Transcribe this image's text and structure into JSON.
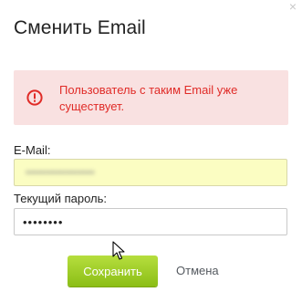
{
  "dialog": {
    "title": "Сменить Email",
    "close_symbol": "×"
  },
  "alert": {
    "icon": "error-circle-icon",
    "message": "Пользователь с таким Email уже существует.",
    "color": "#e02b27",
    "background": "#f9e1e1"
  },
  "form": {
    "email": {
      "label": "E-Mail:",
      "value_blurred": "••••••••••••••••••"
    },
    "password": {
      "label": "Текущий пароль:",
      "value": "••••••••"
    }
  },
  "actions": {
    "save_label": "Сохранить",
    "cancel_label": "Отмена",
    "save_color": "#8bbe16"
  }
}
